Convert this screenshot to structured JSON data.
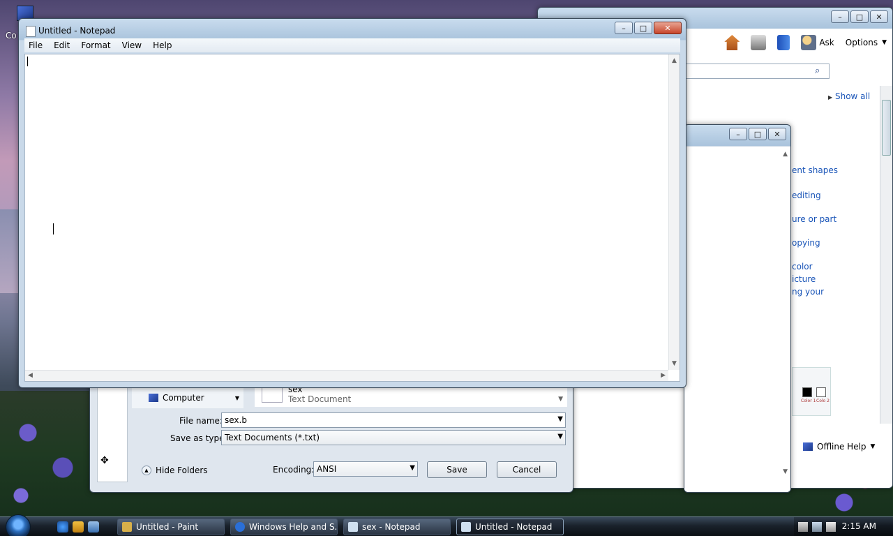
{
  "desktop": {
    "icon_label": "Co"
  },
  "help_window": {
    "toolbar": {
      "ask_label": "Ask",
      "options_label": "Options"
    },
    "show_all": "Show all",
    "partial_links": [
      "ent shapes",
      "editing",
      "ure or part",
      "opying",
      "color",
      "icture",
      "ng your"
    ],
    "offline_help": "Offline Help",
    "swatch_labels": [
      "Color 1",
      "Colo 2"
    ]
  },
  "save_dialog": {
    "nav_computer": "Computer",
    "file_item": {
      "name": "sex",
      "type": "Text Document"
    },
    "file_name_label": "File name:",
    "file_name_value": "sex.b",
    "save_type_label": "Save as type:",
    "save_type_value": "Text Documents (*.txt)",
    "hide_folders": "Hide Folders",
    "encoding_label": "Encoding:",
    "encoding_value": "ANSI",
    "save_button": "Save",
    "cancel_button": "Cancel"
  },
  "notepad": {
    "title": "Untitled - Notepad",
    "menu": [
      "File",
      "Edit",
      "Format",
      "View",
      "Help"
    ]
  },
  "taskbar": {
    "tasks": [
      {
        "label": "Untitled - Paint",
        "icon_color": "#d8b04a"
      },
      {
        "label": "Windows Help and S...",
        "icon_color": "#2a6fd8"
      },
      {
        "label": "sex - Notepad",
        "icon_color": "#cfe0f0"
      },
      {
        "label": "Untitled - Notepad",
        "icon_color": "#cfe0f0"
      }
    ],
    "clock": "2:15 AM"
  }
}
